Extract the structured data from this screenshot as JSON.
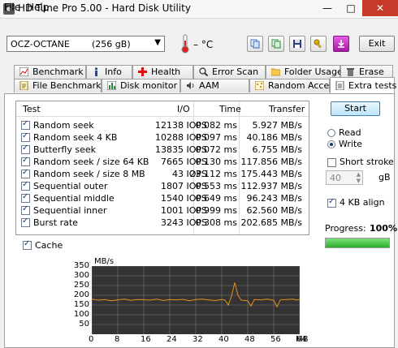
{
  "window": {
    "title": "HD Tune Pro 5.00 - Hard Disk Utility",
    "minimize": "—",
    "maximize": "□",
    "close": "✕"
  },
  "menu": {
    "file": "File",
    "help": "Help"
  },
  "toolbar": {
    "drive_name": "OCZ-OCTANE",
    "drive_size": "(256 gB)",
    "temperature": "– °C",
    "exit_label": "Exit"
  },
  "tabs": {
    "row1": [
      "Benchmark",
      "Info",
      "Health",
      "Error Scan",
      "Folder Usage",
      "Erase"
    ],
    "row2": [
      "File Benchmark",
      "Disk monitor",
      "AAM",
      "Random Access",
      "Extra tests"
    ],
    "active": "Extra tests"
  },
  "table": {
    "headers": {
      "test": "Test",
      "io": "I/O",
      "time": "Time",
      "transfer": "Transfer"
    },
    "rows": [
      {
        "name": "Random seek",
        "io": "12138 IOPS",
        "time": "0.082 ms",
        "transfer": "5.927 MB/s"
      },
      {
        "name": "Random seek 4 KB",
        "io": "10288 IOPS",
        "time": "0.097 ms",
        "transfer": "40.186 MB/s"
      },
      {
        "name": "Butterfly seek",
        "io": "13835 IOPS",
        "time": "0.072 ms",
        "transfer": "6.755 MB/s"
      },
      {
        "name": "Random seek / size 64 KB",
        "io": "7665 IOPS",
        "time": "0.130 ms",
        "transfer": "117.856 MB/s"
      },
      {
        "name": "Random seek / size 8 MB",
        "io": "43 IOPS",
        "time": "23.112 ms",
        "transfer": "175.443 MB/s"
      },
      {
        "name": "Sequential outer",
        "io": "1807 IOPS",
        "time": "0.553 ms",
        "transfer": "112.937 MB/s"
      },
      {
        "name": "Sequential middle",
        "io": "1540 IOPS",
        "time": "0.649 ms",
        "transfer": "96.243 MB/s"
      },
      {
        "name": "Sequential inner",
        "io": "1001 IOPS",
        "time": "0.999 ms",
        "transfer": "62.560 MB/s"
      },
      {
        "name": "Burst rate",
        "io": "3243 IOPS",
        "time": "0.308 ms",
        "transfer": "202.685 MB/s"
      }
    ]
  },
  "controls": {
    "start_label": "Start",
    "read_label": "Read",
    "write_label": "Write",
    "mode": "Write",
    "short_stroke_label": "Short stroke",
    "short_stroke_value": "40",
    "short_stroke_unit": "gB",
    "align_label": "4 KB align",
    "cache_label": "Cache",
    "progress_label": "Progress:",
    "progress_text": "100%",
    "progress_fraction": 1.0
  },
  "colors": {
    "graph_bg": "#333333",
    "graph_grid": "#7a7a7a",
    "graph_line": "#e8901c",
    "progress": "#2db52d"
  },
  "chart_data": {
    "type": "line",
    "ylabel": "MB/s",
    "xunit": "MB",
    "x_ticks": [
      "0",
      "8",
      "16",
      "24",
      "32",
      "40",
      "48",
      "56",
      "64"
    ],
    "y_ticks": [
      "50",
      "100",
      "150",
      "200",
      "250",
      "300",
      "350"
    ],
    "xlim": [
      0,
      64
    ],
    "ylim": [
      0,
      350
    ],
    "series": [
      {
        "x": [
          0,
          2,
          4,
          6,
          8,
          10,
          12,
          14,
          16,
          18,
          20,
          22,
          24,
          26,
          28,
          30,
          32,
          34,
          36,
          38,
          40,
          41,
          42,
          43,
          44,
          45,
          46,
          48,
          49,
          50,
          52,
          54,
          56,
          57,
          58,
          60,
          62,
          63,
          64
        ],
        "y": [
          180,
          175,
          178,
          172,
          176,
          180,
          174,
          178,
          177,
          175,
          180,
          173,
          178,
          176,
          179,
          172,
          178,
          180,
          176,
          173,
          178,
          175,
          150,
          195,
          265,
          200,
          175,
          172,
          145,
          178,
          176,
          180,
          174,
          140,
          176,
          178,
          180,
          175,
          178
        ]
      }
    ]
  }
}
